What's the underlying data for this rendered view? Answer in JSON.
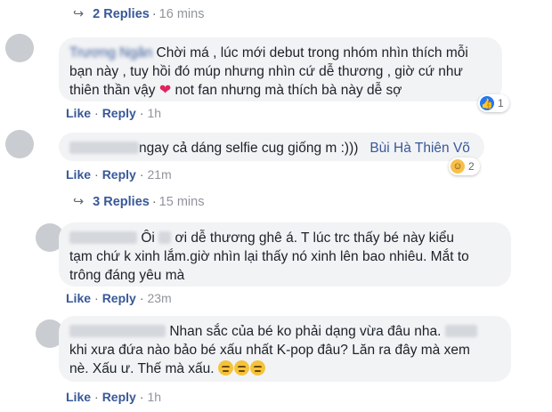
{
  "thread1": {
    "replies": {
      "label": "2 Replies",
      "time": "16 mins"
    },
    "comment": {
      "author_blurred": "Trương Ngân",
      "line1": "Chời má , lúc mới debut trong nhóm nhìn thích mỗi",
      "line2": "bạn này , tuy hồi đó múp nhưng nhìn cứ dễ thương , giờ cứ như",
      "line3a": "thiên thần vậy",
      "line3b": "not fan nhưng mà thích bà này dễ sợ",
      "reaction_count": "1",
      "reaction_icon": "like-icon",
      "actions": {
        "like": "Like",
        "reply": "Reply",
        "time": "1h"
      }
    },
    "reply": {
      "text": "ngay cả dáng selfie cug giống m :)))",
      "tagged": "Bùi Hà Thiên Võ",
      "reaction_count": "2",
      "reaction_icon": "haha-icon",
      "actions": {
        "like": "Like",
        "reply": "Reply",
        "time": "21m"
      }
    }
  },
  "thread2": {
    "replies": {
      "label": "3 Replies",
      "time": "15 mins"
    },
    "comment": {
      "line1a": "Ôi",
      "line1b": "ơi dễ thương ghê á. T lúc trc thấy bé này kiểu",
      "line2": "tạm chứ k xinh lắm.giờ nhìn lại thấy nó xinh lên bao nhiêu. Mắt to",
      "line3": "trông đáng yêu mà",
      "actions": {
        "like": "Like",
        "reply": "Reply",
        "time": "23m"
      }
    },
    "reply": {
      "line1": "Nhan sắc của bé ko phải dạng vừa đâu nha.",
      "line2": "khi xưa đứa nào bảo bé xấu nhất K-pop đâu? Lăn ra đây mà xem",
      "line3": "nè. Xấu ư. Thế mà xấu.",
      "actions": {
        "like": "Like",
        "reply": "Reply",
        "time": "1h"
      }
    }
  },
  "colors": {
    "link": "#385898",
    "bubble": "#f2f3f5",
    "meta": "#90949c"
  }
}
